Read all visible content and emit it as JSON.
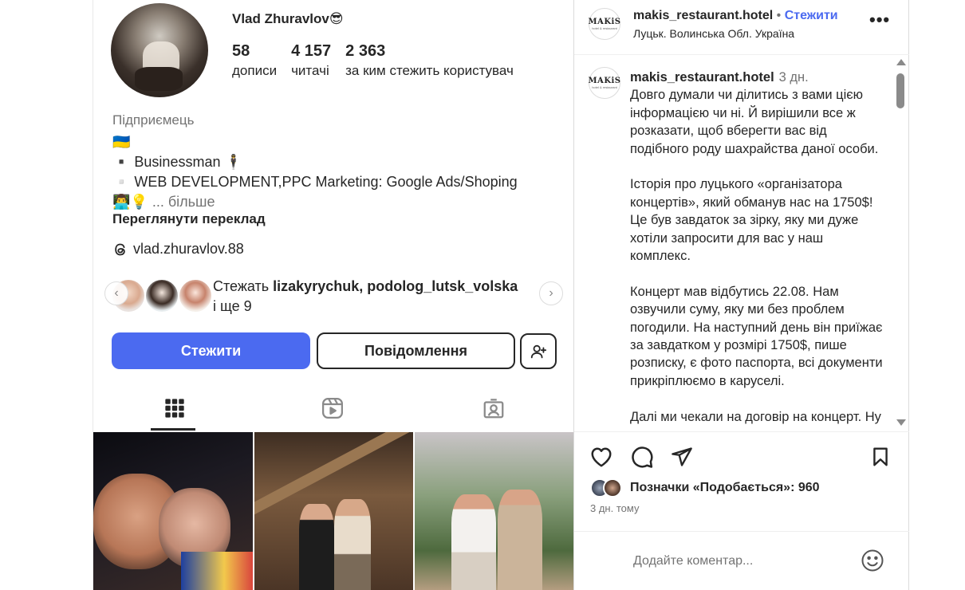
{
  "profile": {
    "username": "Vlad Zhuravlov😎",
    "stats": [
      {
        "num": "58",
        "label": "дописи"
      },
      {
        "num": "4 157",
        "label": "читачі"
      },
      {
        "num": "2 363",
        "label": "за ким стежить користувач"
      }
    ],
    "category": "Підприємець",
    "bio_flag": "🇺🇦",
    "bio_line1": "▪️ Businessman 🕴",
    "bio_line2": "▫️ WEB DEVELOPMENT,PPC Marketing: Google Ads/Shoping",
    "bio_line3_emoji": "👨‍💻💡",
    "bio_more": "... більше",
    "translate_label": "Переглянути переклад",
    "threads_handle": "vlad.zhuravlov.88",
    "followed_by_prefix": "Стежать",
    "followed_by_names": "lizakyrychuk, podolog_lutsk_volska",
    "followed_by_suffix": "і ще 9",
    "follow_button": "Стежити",
    "message_button": "Повідомлення",
    "carousel_total_dots": 5,
    "carousel_active_dot": 3
  },
  "post": {
    "account": "makis_restaurant.hotel",
    "separator": "•",
    "follow_label": "Стежити",
    "location": "Луцьк. Волинська Обл. Україна",
    "more_label": "•••",
    "logo_word": "MAKiS",
    "logo_sub": "hotel & restaurant",
    "caption_author": "makis_restaurant.hotel",
    "caption_time": "3 дн.",
    "caption_p1": "Довго думали чи ділитись з вами цією інформацією чи ні. Й вирішили все ж розказати, щоб вберегти вас від подібного роду шахрайства даної особи.",
    "caption_p2": "Історія про луцького «організатора концертів», який обманув нас на 1750$! Це був завдаток за зірку, яку ми дуже хотіли запросити для вас у наш комплекс.",
    "caption_p3": "Концерт мав відбутись 22.08. Нам озвучили суму, яку ми без проблем погодили. На наступний день він приїжає за завдатком у розмірі 1750$, пише розписку, є фото паспорта, всі документи прикріплюємо в каруселі.",
    "caption_p4": "Далі ми чекали на договір на концерт. Ну",
    "likes_label": "Позначки «Подобається»: 960",
    "time_ago": "3 дн. тому",
    "comment_placeholder": "Додайте коментар..."
  }
}
